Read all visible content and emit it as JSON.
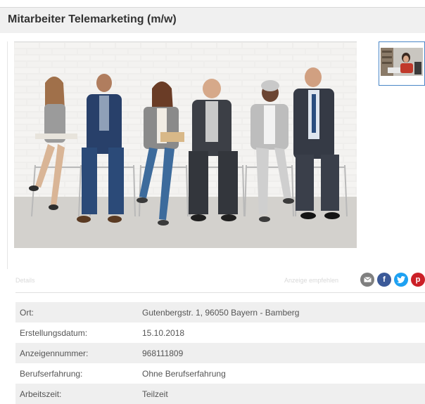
{
  "listing": {
    "title": "Mitarbeiter Telemarketing (m/w)"
  },
  "images": {
    "main_alt": "Stock photo",
    "thumbnail_count": 1
  },
  "share": {
    "faint_left_text": "Details",
    "faint_right_text": "Anzeige empfehlen",
    "icons": [
      "email-icon",
      "facebook-icon",
      "twitter-icon",
      "pinterest-icon"
    ],
    "colors": {
      "email": "#7f7f7f",
      "facebook": "#3b5998",
      "twitter": "#1da1f2",
      "pinterest": "#cb2027"
    }
  },
  "details": {
    "rows": [
      {
        "label": "Ort:",
        "value": "Gutenbergstr. 1, 96050 Bayern - Bamberg"
      },
      {
        "label": "Erstellungsdatum:",
        "value": "15.10.2018"
      },
      {
        "label": "Anzeigennummer:",
        "value": "968111809"
      },
      {
        "label": "Berufserfahrung:",
        "value": "Ohne Berufserfahrung"
      },
      {
        "label": "Arbeitszeit:",
        "value": "Teilzeit"
      }
    ]
  }
}
